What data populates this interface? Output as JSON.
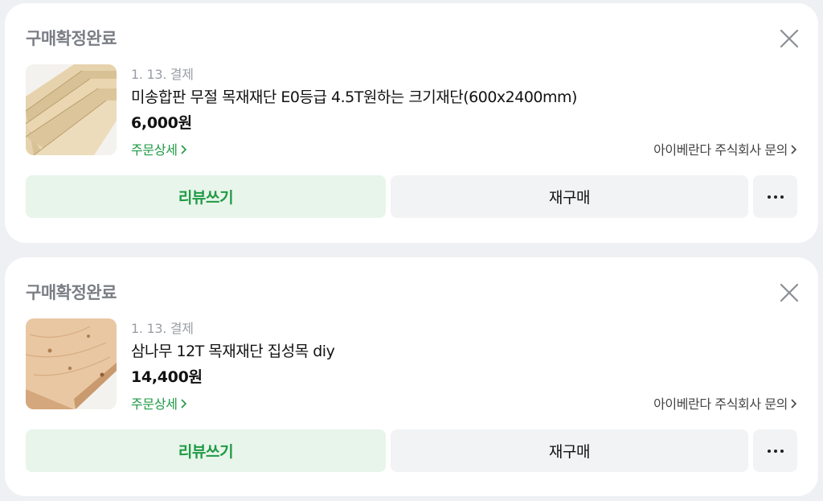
{
  "orders": [
    {
      "status": "구매확정완료",
      "date": "1. 13. 결제",
      "title": "미송합판 무절 목재재단 E0등급 4.5T원하는 크기재단(600x2400mm)",
      "price": "6,000원",
      "detail_link": "주문상세",
      "seller_link": "아이베란다 주식회사 문의",
      "review_button": "리뷰쓰기",
      "rebuy_button": "재구매",
      "thumbnail_icon": "plywood-stack-image"
    },
    {
      "status": "구매확정완료",
      "date": "1. 13. 결제",
      "title": "삼나무 12T 목재재단 집성목 diy",
      "price": "14,400원",
      "detail_link": "주문상세",
      "seller_link": "아이베란다 주식회사 문의",
      "review_button": "리뷰쓰기",
      "rebuy_button": "재구매",
      "thumbnail_icon": "cedar-board-image"
    }
  ],
  "colors": {
    "accent_green": "#1f9a45",
    "review_bg": "#e8f5ea",
    "button_gray": "#f2f3f5",
    "page_bg": "#eef0f3"
  }
}
